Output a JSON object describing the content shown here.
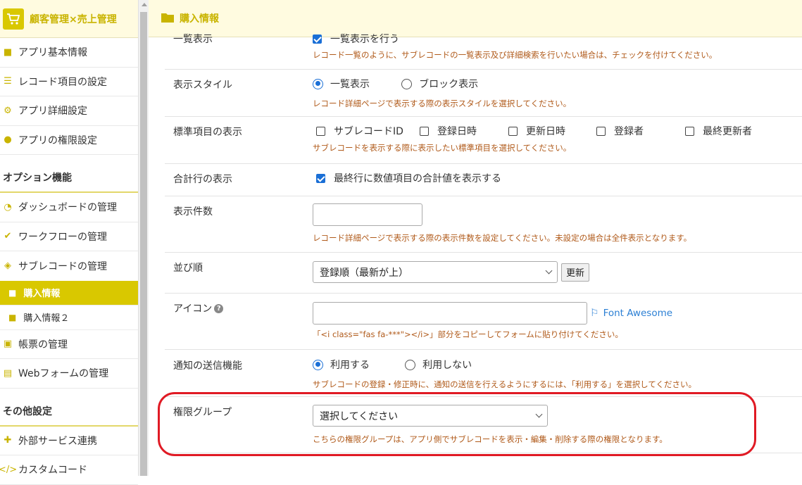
{
  "brand": {
    "title": "顧客管理×売上管理",
    "icon": "cart-icon"
  },
  "sidebar": {
    "items": [
      {
        "label": "アプリ基本情報",
        "icon": "info-icon"
      },
      {
        "label": "レコード項目の設定",
        "icon": "list-icon"
      },
      {
        "label": "アプリ詳細設定",
        "icon": "gear-icon"
      },
      {
        "label": "アプリの権限設定",
        "icon": "user-lock-icon"
      }
    ],
    "options_title": "オプション機能",
    "option_items": [
      {
        "label": "ダッシュボードの管理",
        "icon": "dashboard-icon"
      },
      {
        "label": "ワークフローの管理",
        "icon": "user-check-icon"
      },
      {
        "label": "サブレコードの管理",
        "icon": "layers-icon"
      }
    ],
    "sub_items": [
      {
        "label": "購入情報",
        "icon": "folder-icon",
        "active": true
      },
      {
        "label": "購入情報２",
        "icon": "folder-icon",
        "active": false
      }
    ],
    "option_items2": [
      {
        "label": "帳票の管理",
        "icon": "excel-icon"
      },
      {
        "label": "Webフォームの管理",
        "icon": "form-icon"
      }
    ],
    "other_title": "その他設定",
    "other_items": [
      {
        "label": "外部サービス連携",
        "icon": "puzzle-icon"
      },
      {
        "label": "カスタムコード",
        "icon": "code-icon"
      }
    ]
  },
  "header": {
    "title": "購入情報"
  },
  "form": {
    "top_row": {
      "label": "一覧表示",
      "check_label": "一覧表示を行う",
      "help": "レコード一覧のように、サブレコードの一覧表示及び詳細検索を行いたい場合は、チェックを付けてください。"
    },
    "style_row": {
      "label": "表示スタイル",
      "opt1": "一覧表示",
      "opt2": "ブロック表示",
      "help": "レコード詳細ページで表示する際の表示スタイルを選択してください。"
    },
    "standard_row": {
      "label": "標準項目の表示",
      "opts": [
        "サブレコードID",
        "登録日時",
        "更新日時",
        "登録者",
        "最終更新者"
      ],
      "help": "サブレコードを表示する際に表示したい標準項目を選択してください。"
    },
    "total_row": {
      "label": "合計行の表示",
      "check_label": "最終行に数値項目の合計値を表示する"
    },
    "count_row": {
      "label": "表示件数",
      "value": "",
      "help": "レコード詳細ページで表示する際の表示件数を設定してください。未設定の場合は全件表示となります。"
    },
    "order_row": {
      "label": "並び順",
      "selected": "登録順（最新が上）",
      "button": "更新"
    },
    "icon_row": {
      "label": "アイコン",
      "value": "",
      "link": "Font Awesome",
      "help": "「<i class=\"fas fa-***\"></i>」部分をコピーしてフォームに貼り付けてください。"
    },
    "notify_row": {
      "label": "通知の送信機能",
      "opt1": "利用する",
      "opt2": "利用しない",
      "help": "サブレコードの登録・修正時に、通知の送信を行えるようにするには、「利用する」を選択してください。"
    },
    "group_row": {
      "label": "権限グループ",
      "selected": "選択してください",
      "help": "こちらの権限グループは、アプリ側でサブレコードを表示・編集・削除する際の権限となります。"
    }
  },
  "colors": {
    "accent": "#d9c800",
    "help": "#b05a1a",
    "highlight": "#e01a24",
    "link": "#2b7fd4"
  }
}
